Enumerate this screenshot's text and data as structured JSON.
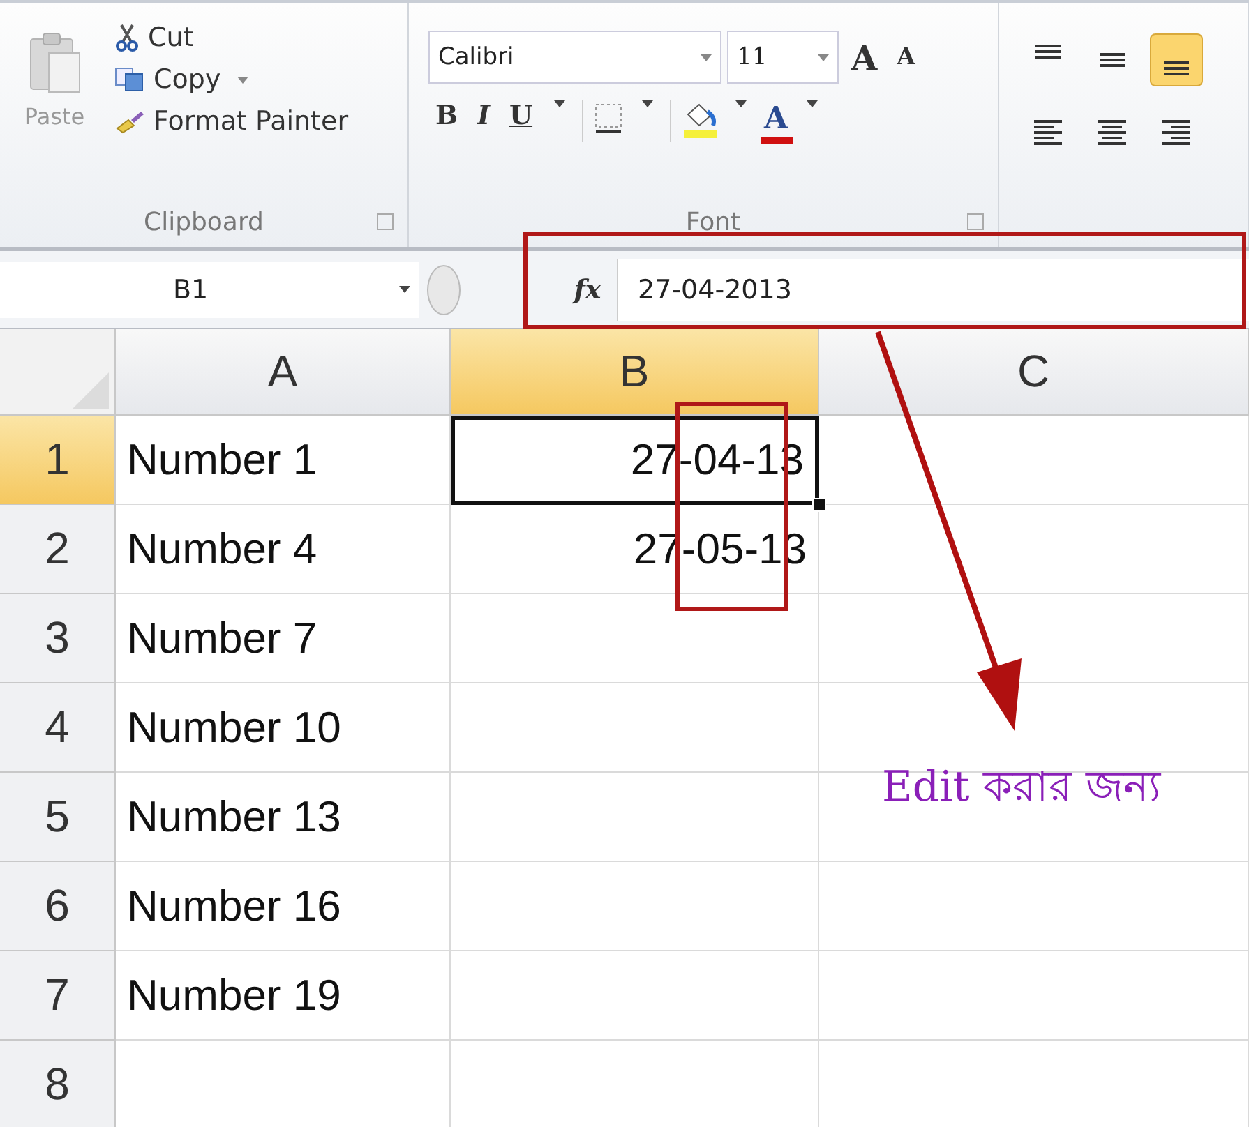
{
  "ribbon": {
    "clipboard": {
      "paste": "Paste",
      "cut": "Cut",
      "copy": "Copy",
      "format_painter": "Format Painter",
      "group_label": "Clipboard"
    },
    "font": {
      "name": "Calibri",
      "size": "11",
      "grow": "A",
      "shrink": "A",
      "bold": "B",
      "italic": "I",
      "underline": "U",
      "font_color": "A",
      "group_label": "Font"
    },
    "alignment": {
      "vertical": [
        {
          "selected": false
        },
        {
          "selected": false
        },
        {
          "selected": true
        }
      ],
      "horizontal": [
        {
          "kind": "left"
        },
        {
          "kind": "center"
        },
        {
          "kind": "right"
        }
      ]
    }
  },
  "formula_bar": {
    "name_box": "B1",
    "fx": "fx",
    "value": "27-04-2013"
  },
  "columns": [
    {
      "label": "A",
      "selected": false
    },
    {
      "label": "B",
      "selected": true
    },
    {
      "label": "C",
      "selected": false
    }
  ],
  "rows": [
    {
      "number": "1",
      "selected": true,
      "cells": [
        "Number 1",
        "27-04-13",
        ""
      ]
    },
    {
      "number": "2",
      "selected": false,
      "cells": [
        "Number 4",
        "27-05-13",
        ""
      ]
    },
    {
      "number": "3",
      "selected": false,
      "cells": [
        "Number 7",
        "",
        ""
      ]
    },
    {
      "number": "4",
      "selected": false,
      "cells": [
        "Number 10",
        "",
        ""
      ]
    },
    {
      "number": "5",
      "selected": false,
      "cells": [
        "Number 13",
        "",
        ""
      ]
    },
    {
      "number": "6",
      "selected": false,
      "cells": [
        "Number 16",
        "",
        ""
      ]
    },
    {
      "number": "7",
      "selected": false,
      "cells": [
        "Number 19",
        "",
        ""
      ]
    },
    {
      "number": "8",
      "selected": false,
      "cells": [
        "",
        "",
        ""
      ]
    }
  ],
  "annotation": {
    "text": "Edit করার জন্য"
  }
}
